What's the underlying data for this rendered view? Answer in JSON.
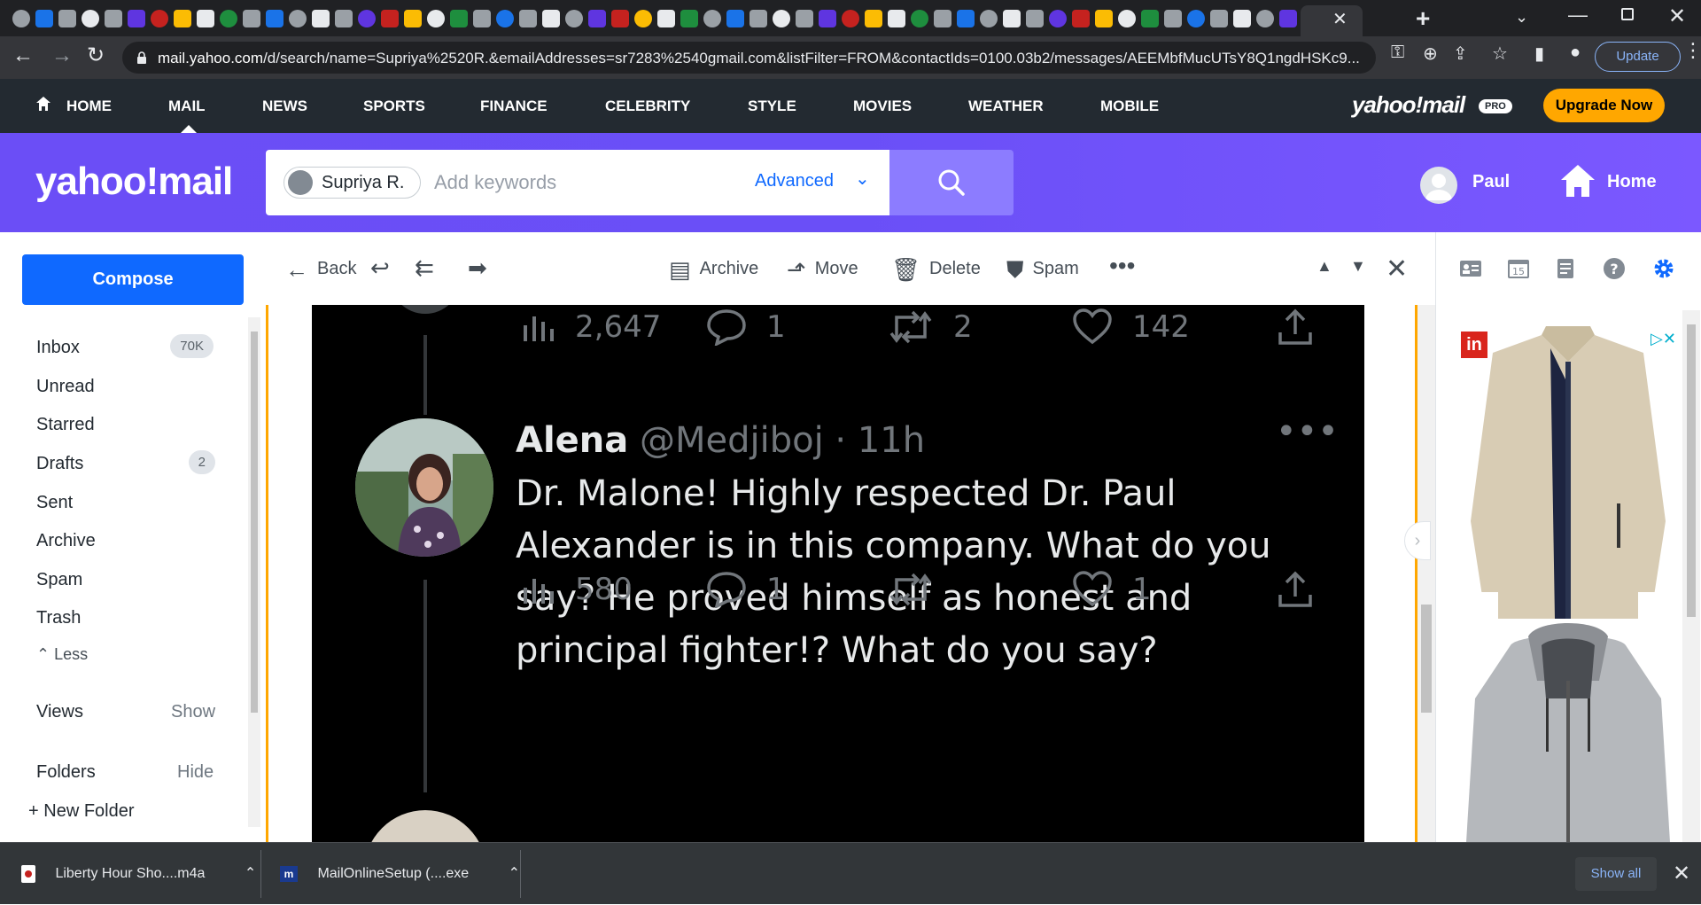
{
  "browser": {
    "tab_close": "✕",
    "new_tab": "+",
    "url_host": "mail.yahoo.com",
    "url_path": "/d/search/name=Supriya%2520R.&emailAddresses=sr7283%2540gmail.com&listFilter=FROM&contactIds=0100.03b2/messages/AEEMbfMucUTsY8Q1ngdHSKc9...",
    "update_label": "Update"
  },
  "topnav": {
    "items": [
      "HOME",
      "MAIL",
      "NEWS",
      "SPORTS",
      "FINANCE",
      "CELEBRITY",
      "STYLE",
      "MOVIES",
      "WEATHER",
      "MOBILE"
    ],
    "active": "MAIL",
    "logo": "yahoo!mail",
    "pro_badge": "PRO",
    "upgrade_label": "Upgrade Now"
  },
  "header": {
    "logo": "yahoo!mail",
    "search_chip": "Supriya R.",
    "search_placeholder": "Add keywords",
    "advanced_label": "Advanced",
    "profile_name": "Paul",
    "home_label": "Home"
  },
  "sidebar": {
    "compose_label": "Compose",
    "folders": [
      {
        "label": "Inbox",
        "count": "70K"
      },
      {
        "label": "Unread",
        "count": ""
      },
      {
        "label": "Starred",
        "count": ""
      },
      {
        "label": "Drafts",
        "count": "2"
      },
      {
        "label": "Sent",
        "count": ""
      },
      {
        "label": "Archive",
        "count": ""
      },
      {
        "label": "Spam",
        "count": ""
      },
      {
        "label": "Trash",
        "count": ""
      }
    ],
    "less_label": "Less",
    "views_label": "Views",
    "views_action": "Show",
    "folders_label": "Folders",
    "folders_action": "Hide",
    "new_folder_label": "New Folder"
  },
  "message_toolbar": {
    "back": "Back",
    "archive": "Archive",
    "move": "Move",
    "delete": "Delete",
    "spam": "Spam"
  },
  "tweet_prev_stats": {
    "views": "2,647",
    "replies": "1",
    "retweets": "2",
    "likes": "142"
  },
  "tweet": {
    "name": "Alena",
    "handle": "@Medjiboj",
    "time": "11h",
    "text": "Dr. Malone! Highly respected Dr. Paul Alexander is in this company. What do you say? He proved himself as honest and principal fighter!? What do you say?",
    "views": "580",
    "replies": "1",
    "retweets": "",
    "likes": "1"
  },
  "downloads": {
    "items": [
      "Liberty Hour Sho....m4a",
      "MailOnlineSetup (....exe"
    ],
    "show_all": "Show all"
  }
}
